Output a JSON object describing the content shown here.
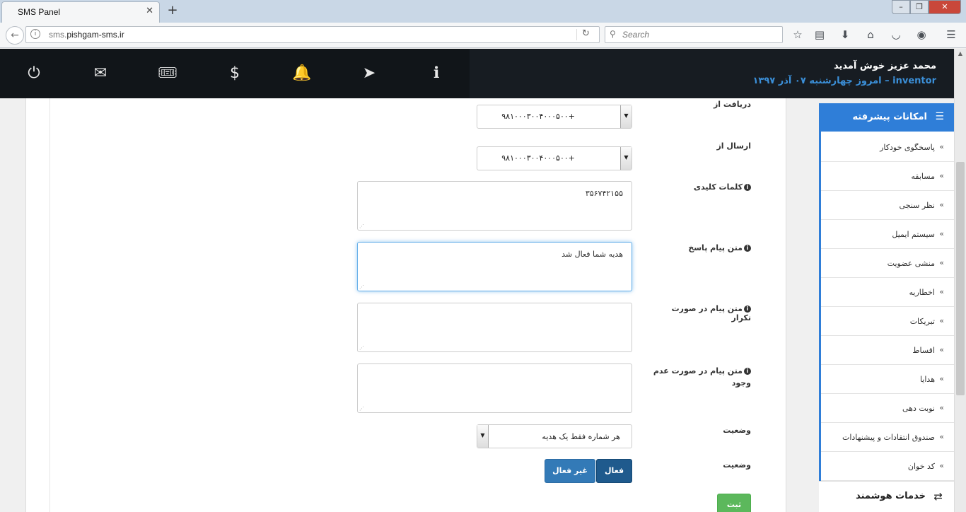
{
  "browser": {
    "tab_title": "SMS Panel",
    "tab_close": "✕",
    "new_tab": "+",
    "url_prefix": "sms.",
    "url_domain": "pishgam-sms.ir",
    "search_placeholder": "Search"
  },
  "header": {
    "welcome": "محمد عزیز خوش آمدید",
    "user": "inventor",
    "date": "– امروز چهارشنبه ۰۷ آذر ۱۳۹۷"
  },
  "form": {
    "receive_from_label": "دریافت از",
    "receive_from_value": "+۹۸۱۰۰۰۳۰۰۴۰۰۰۵۰۰",
    "send_from_label": "ارسال از",
    "send_from_value": "+۹۸۱۰۰۰۳۰۰۴۰۰۰۵۰۰",
    "keywords_label": "کلمات کلیدی",
    "keywords_value": "۳۵۶۷۴۲۱۵۵",
    "reply_text_label": "متن پیام پاسخ",
    "reply_text_value": "هدیه شما فعال شد",
    "repeat_text_label": "متن پیام در صورت تکرار",
    "repeat_text_value": "",
    "notfound_text_label": "متن پیام در صورت عدم وجود",
    "notfound_text_value": "",
    "status1_label": "وضعیت",
    "status1_value": "هر شماره فقط یک هدیه",
    "status2_label": "وضعیت",
    "btn_active": "فعال",
    "btn_inactive": "غیر فعال",
    "btn_submit": "ثبت"
  },
  "sidebar": {
    "title": "امکانات پیشرفته",
    "items": [
      {
        "label": "پاسخگوی خودکار"
      },
      {
        "label": "مسابقه"
      },
      {
        "label": "نظر سنجی"
      },
      {
        "label": "سیستم ایمیل"
      },
      {
        "label": "منشی عضویت"
      },
      {
        "label": "اخطاریه"
      },
      {
        "label": "تبریکات"
      },
      {
        "label": "اقساط"
      },
      {
        "label": "هدایا"
      },
      {
        "label": "نوبت دهی"
      },
      {
        "label": "صندوق انتقادات و پیشنهادات"
      },
      {
        "label": "کد خوان"
      }
    ],
    "footer": "خدمات هوشمند"
  },
  "colors": {
    "header_bg": "#171c22",
    "accent": "#2f7ed8",
    "date_color": "#3b8fd8",
    "submit_green": "#5cb85c"
  }
}
